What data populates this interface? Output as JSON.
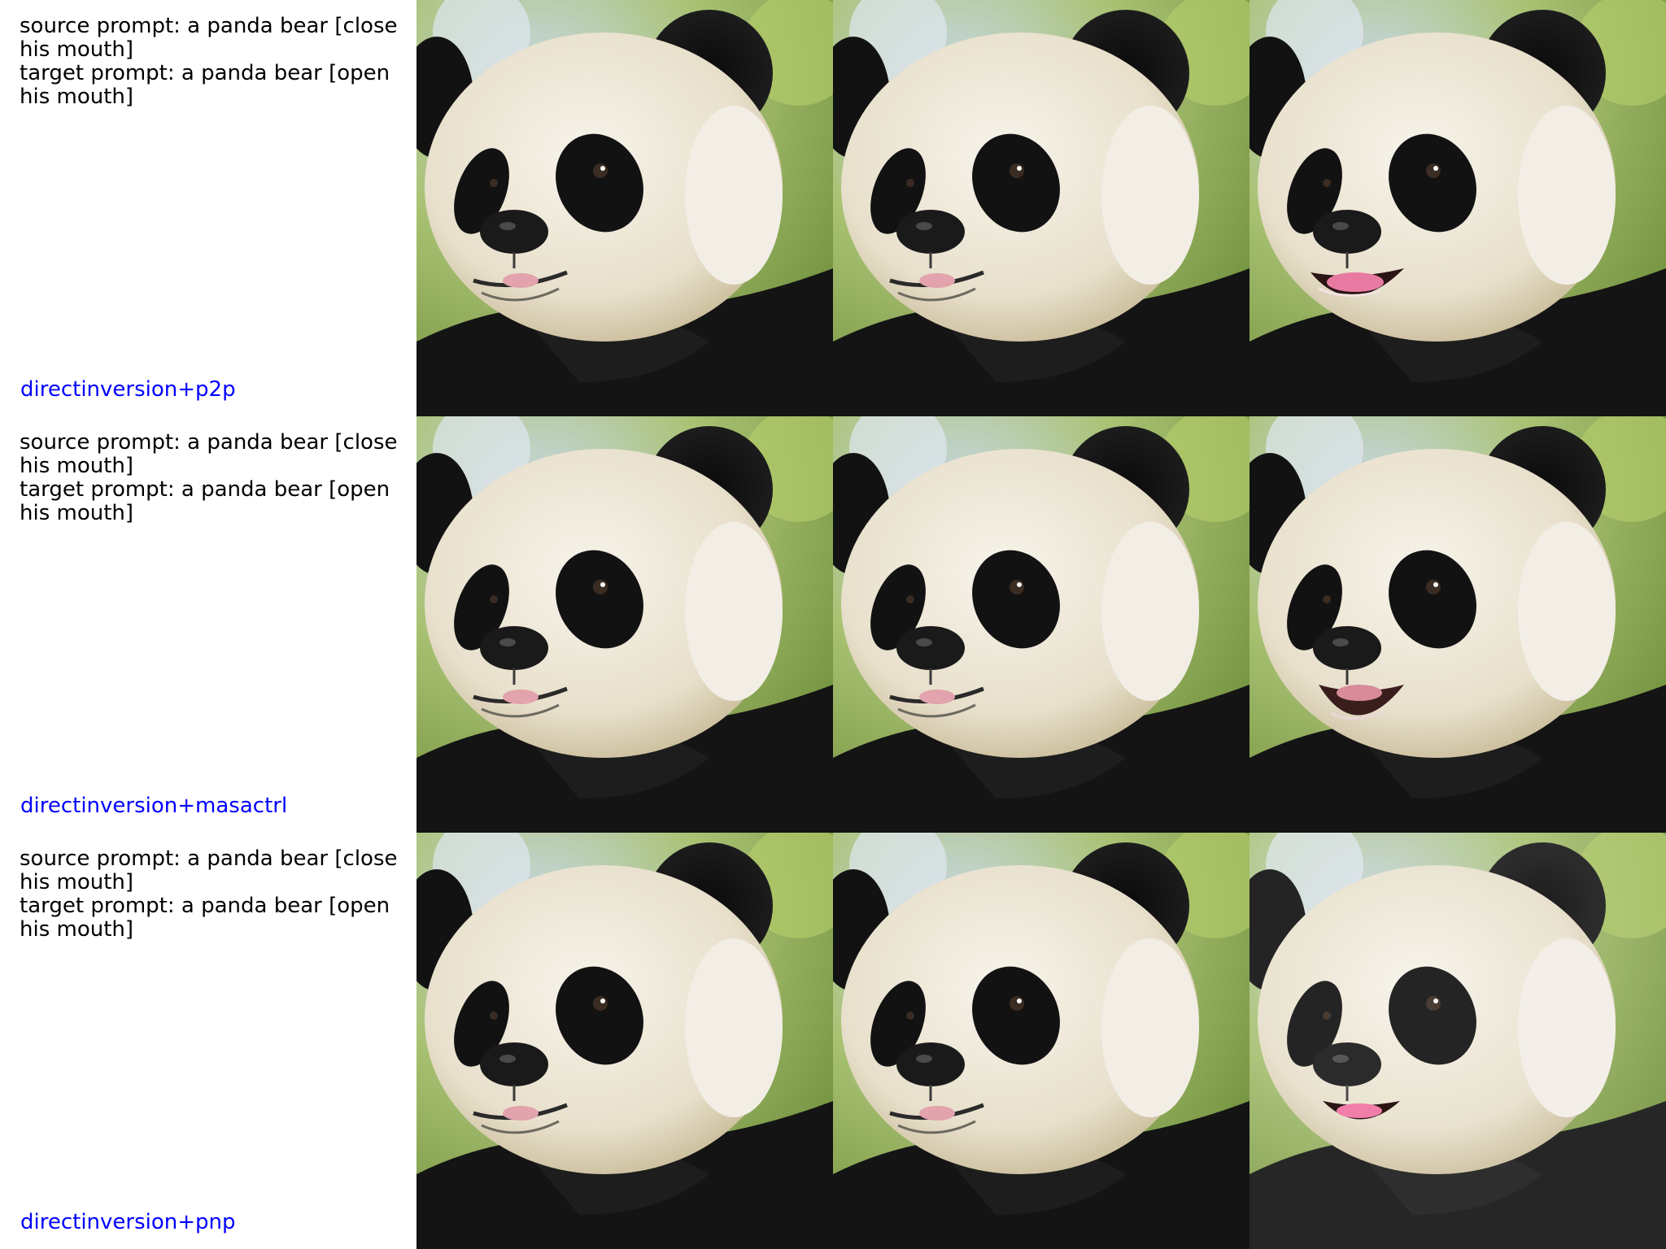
{
  "rows": [
    {
      "source_prompt": "source prompt: a panda bear [close his mouth]",
      "target_prompt": "target prompt: a panda bear [open his mouth]",
      "method": "directinversion+p2p",
      "images": [
        {
          "name": "panda-photo-source",
          "mouth": "closed"
        },
        {
          "name": "panda-photo-reconstruction",
          "mouth": "closed"
        },
        {
          "name": "panda-photo-edited",
          "mouth": "open"
        }
      ]
    },
    {
      "source_prompt": "source prompt: a panda bear [close his mouth]",
      "target_prompt": "target prompt: a panda bear [open his mouth]",
      "method": "directinversion+masactrl",
      "images": [
        {
          "name": "panda-photo-source",
          "mouth": "closed"
        },
        {
          "name": "panda-photo-reconstruction",
          "mouth": "closed"
        },
        {
          "name": "panda-photo-edited",
          "mouth": "open"
        }
      ]
    },
    {
      "source_prompt": "source prompt: a panda bear [close his mouth]",
      "target_prompt": "target prompt: a panda bear [open his mouth]",
      "method": "directinversion+pnp",
      "images": [
        {
          "name": "panda-photo-source",
          "mouth": "closed"
        },
        {
          "name": "panda-photo-reconstruction",
          "mouth": "closed"
        },
        {
          "name": "panda-photo-edited",
          "mouth": "open"
        }
      ]
    }
  ],
  "colors": {
    "method_label": "#0000ff",
    "prompt_text": "#000000",
    "panda_fur_white": "#eee9dc",
    "panda_fur_black": "#121212",
    "background_foliage": "#9dbb5a",
    "background_sky": "#c9d8e6"
  }
}
